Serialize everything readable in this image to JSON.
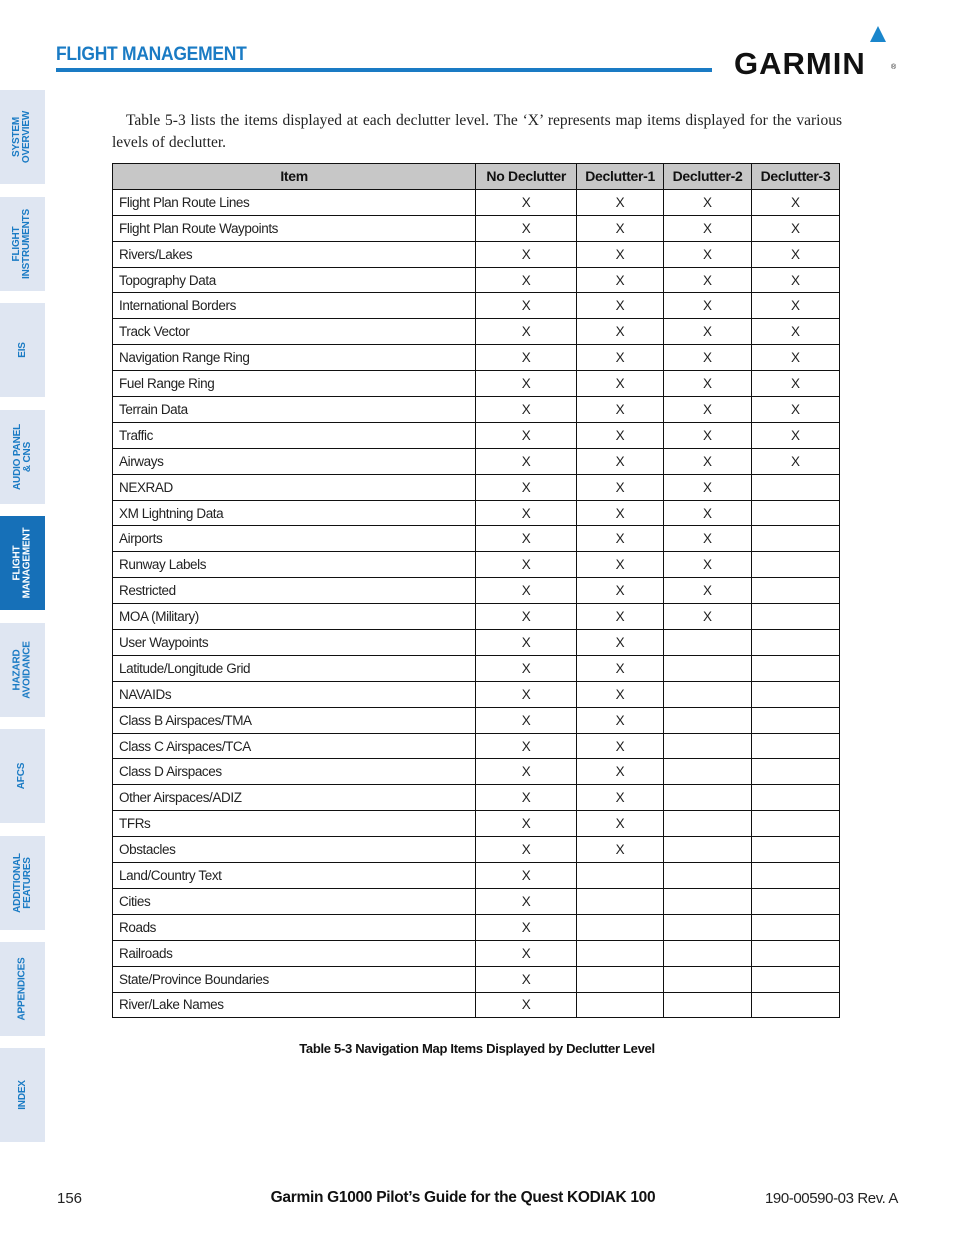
{
  "header": {
    "section_title": "FLIGHT MANAGEMENT",
    "logo_text": "GARMIN",
    "logo_registered": "®",
    "accent_color": "#1a7bc4"
  },
  "sidebar": {
    "tabs": [
      {
        "label": "SYSTEM\nOVERVIEW",
        "active": false
      },
      {
        "label": "FLIGHT\nINSTRUMENTS",
        "active": false
      },
      {
        "label": "EIS",
        "active": false
      },
      {
        "label": "AUDIO PANEL\n& CNS",
        "active": false
      },
      {
        "label": "FLIGHT\nMANAGEMENT",
        "active": true
      },
      {
        "label": "HAZARD\nAVOIDANCE",
        "active": false
      },
      {
        "label": "AFCS",
        "active": false
      },
      {
        "label": "ADDITIONAL\nFEATURES",
        "active": false
      },
      {
        "label": "APPENDICES",
        "active": false
      },
      {
        "label": "INDEX",
        "active": false
      }
    ]
  },
  "body": {
    "intro": "Table 5-3 lists the items displayed at each declutter level.  The ‘X’ represents map items displayed for the various levels of declutter."
  },
  "table": {
    "headers": [
      "Item",
      "No Declutter",
      "Declutter-1",
      "Declutter-2",
      "Declutter-3"
    ],
    "rows": [
      [
        "Flight Plan Route Lines",
        "X",
        "X",
        "X",
        "X"
      ],
      [
        "Flight Plan Route Waypoints",
        "X",
        "X",
        "X",
        "X"
      ],
      [
        "Rivers/Lakes",
        "X",
        "X",
        "X",
        "X"
      ],
      [
        "Topography Data",
        "X",
        "X",
        "X",
        "X"
      ],
      [
        "International Borders",
        "X",
        "X",
        "X",
        "X"
      ],
      [
        "Track Vector",
        "X",
        "X",
        "X",
        "X"
      ],
      [
        "Navigation Range Ring",
        "X",
        "X",
        "X",
        "X"
      ],
      [
        "Fuel Range Ring",
        "X",
        "X",
        "X",
        "X"
      ],
      [
        "Terrain Data",
        "X",
        "X",
        "X",
        "X"
      ],
      [
        "Traffic",
        "X",
        "X",
        "X",
        "X"
      ],
      [
        "Airways",
        "X",
        "X",
        "X",
        "X"
      ],
      [
        "NEXRAD",
        "X",
        "X",
        "X",
        ""
      ],
      [
        "XM Lightning Data",
        "X",
        "X",
        "X",
        ""
      ],
      [
        "Airports",
        "X",
        "X",
        "X",
        ""
      ],
      [
        "Runway Labels",
        "X",
        "X",
        "X",
        ""
      ],
      [
        "Restricted",
        "X",
        "X",
        "X",
        ""
      ],
      [
        "MOA (Military)",
        "X",
        "X",
        "X",
        ""
      ],
      [
        "User Waypoints",
        "X",
        "X",
        "",
        ""
      ],
      [
        "Latitude/Longitude Grid",
        "X",
        "X",
        "",
        ""
      ],
      [
        "NAVAIDs",
        "X",
        "X",
        "",
        ""
      ],
      [
        "Class B Airspaces/TMA",
        "X",
        "X",
        "",
        ""
      ],
      [
        "Class C Airspaces/TCA",
        "X",
        "X",
        "",
        ""
      ],
      [
        "Class D Airspaces",
        "X",
        "X",
        "",
        ""
      ],
      [
        "Other Airspaces/ADIZ",
        "X",
        "X",
        "",
        ""
      ],
      [
        "TFRs",
        "X",
        "X",
        "",
        ""
      ],
      [
        "Obstacles",
        "X",
        "X",
        "",
        ""
      ],
      [
        "Land/Country Text",
        "X",
        "",
        "",
        ""
      ],
      [
        "Cities",
        "X",
        "",
        "",
        ""
      ],
      [
        "Roads",
        "X",
        "",
        "",
        ""
      ],
      [
        "Railroads",
        "X",
        "",
        "",
        ""
      ],
      [
        "State/Province Boundaries",
        "X",
        "",
        "",
        ""
      ],
      [
        "River/Lake Names",
        "X",
        "",
        "",
        ""
      ]
    ],
    "caption": "Table 5-3 Navigation Map Items Displayed by Declutter Level"
  },
  "footer": {
    "page_number": "156",
    "title": "Garmin G1000 Pilot’s Guide for the Quest KODIAK 100",
    "doc_number": "190-00590-03  Rev. A"
  }
}
